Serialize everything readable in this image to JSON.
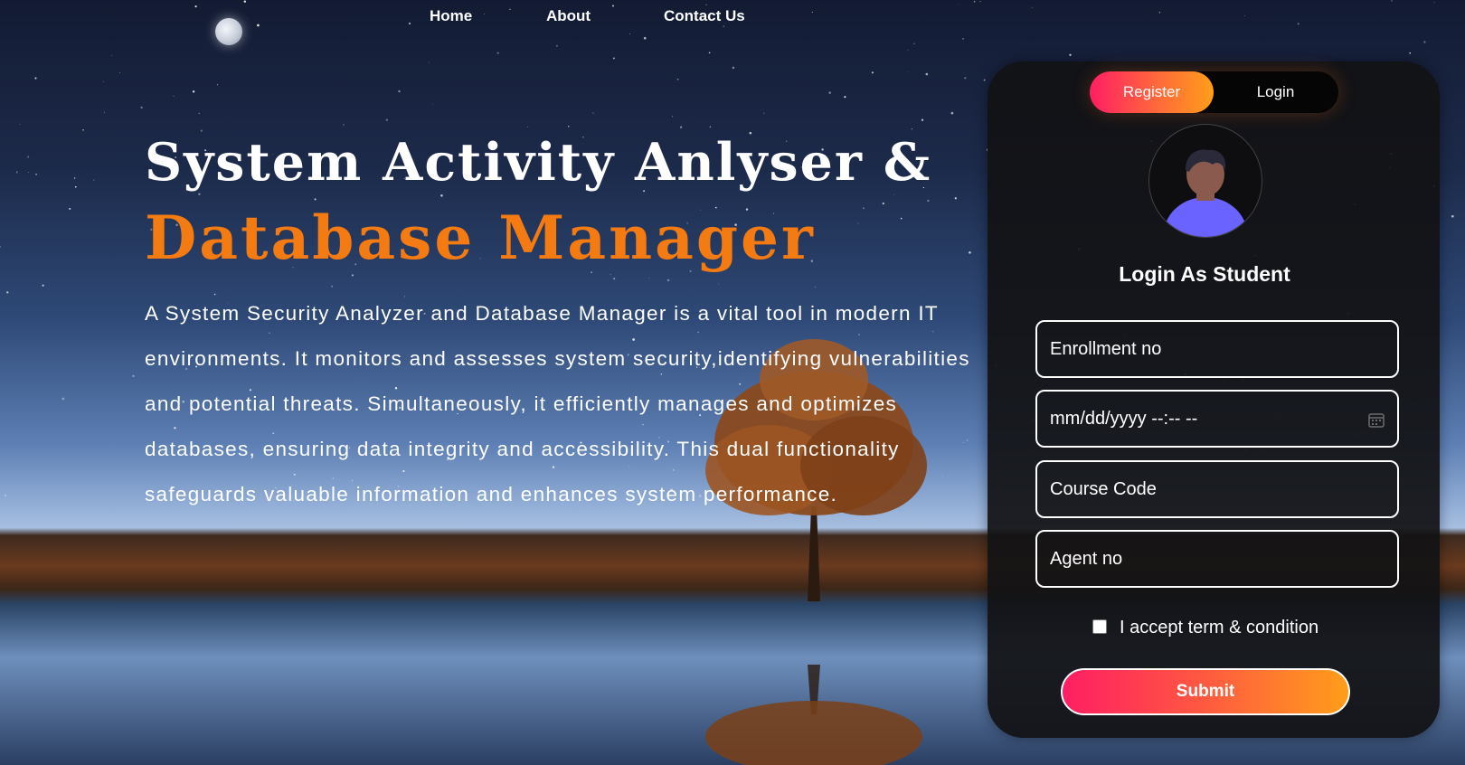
{
  "nav": {
    "home": "Home",
    "about": "About",
    "contact": "Contact Us"
  },
  "hero": {
    "title_line1": "System Activity Anlyser &",
    "title_line2": "Database Manager",
    "description": "A System Security Analyzer and Database Manager is a vital tool in modern IT environments. It monitors and assesses system security,identifying vulnerabilities and potential threats. Simultaneously, it efficiently manages and optimizes databases, ensuring data integrity and accessibility. This dual functionality safeguards valuable information and enhances system performance."
  },
  "auth_card": {
    "tabs": {
      "register": "Register",
      "login": "Login",
      "active": "register"
    },
    "title": "Login As Student",
    "fields": {
      "enrollment": "Enrollment no",
      "datetime": "mm/dd/yyyy --:-- --",
      "course_code": "Course Code",
      "agent_no": "Agent no"
    },
    "terms_label": "I accept term & condition",
    "terms_checked": false,
    "submit_label": "Submit"
  },
  "icons": {
    "moon": "moon-icon",
    "avatar": "user-avatar-icon",
    "calendar": "calendar-icon"
  },
  "colors": {
    "accent_orange": "#f47a12",
    "gradient_start": "#ff1e63",
    "gradient_end": "#ff9e1a",
    "card_bg": "#121214"
  }
}
